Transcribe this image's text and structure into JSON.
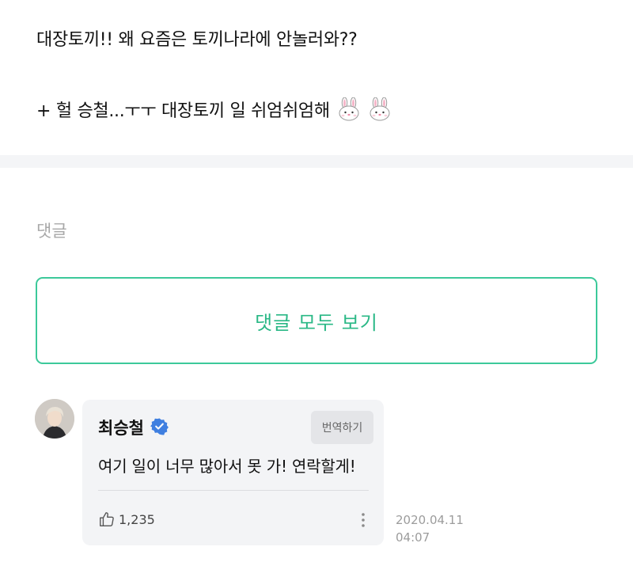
{
  "post": {
    "line1": "대장토끼!! 왜 요즘은 토끼나라에 안놀러와??",
    "line2": "+ 헐 승철...ㅜㅜ 대장토끼 일 쉬엄쉬엄해",
    "line2_emoji": "rabbit-face-icon x2"
  },
  "comments": {
    "heading": "댓글",
    "view_all_label": "댓글 모두 보기"
  },
  "comment": {
    "author": "최승철",
    "verified": "verified-badge-icon",
    "translate_label": "번역하기",
    "text": "여기 일이 너무 많아서 못 가! 연락할게!",
    "likes": "1,235",
    "date": "2020.04.11",
    "time": "04:07"
  },
  "colors": {
    "accent_green": "#2ab886",
    "verified_blue": "#3f7fe0",
    "bubble_bg": "#f3f4f6"
  }
}
